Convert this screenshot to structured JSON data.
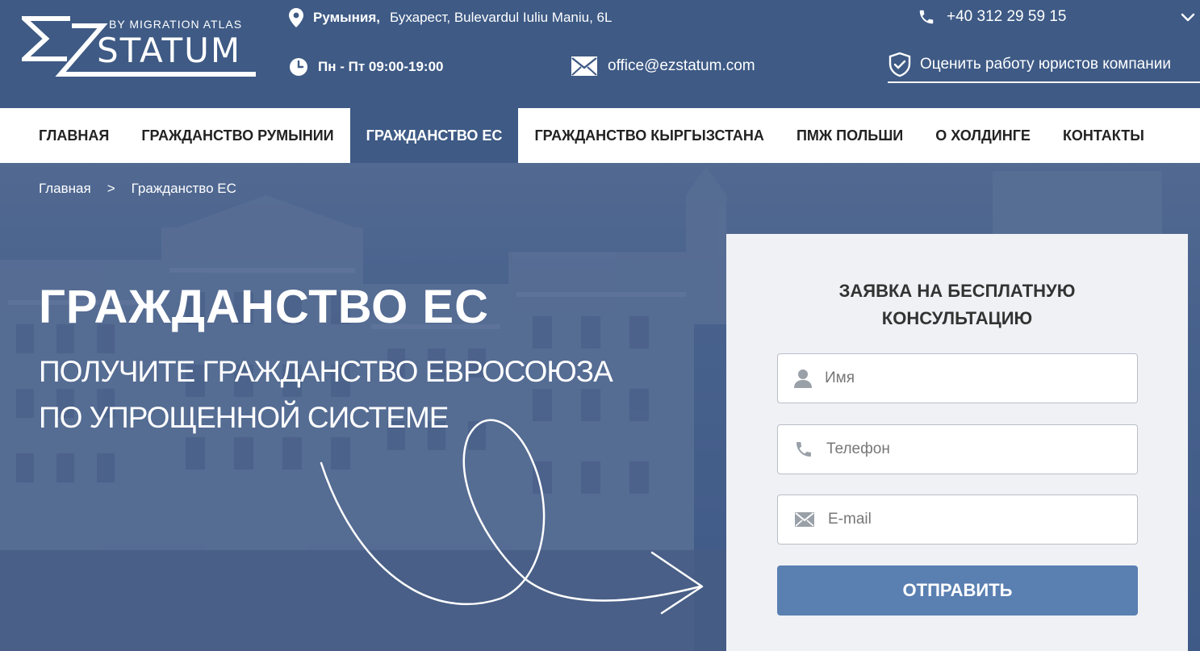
{
  "logo": {
    "tagline": "BY MIGRATION ATLAS",
    "wordmark": "STATUM"
  },
  "header": {
    "country": "Румыния,",
    "street": "Бухарест, Bulevardul Iuliu Maniu, 6L",
    "hours": "Пн - Пт  09:00-19:00",
    "email": "office@ezstatum.com",
    "phone": "+40 312 29 59 15",
    "rate_label": "Оценить работу юристов компании"
  },
  "nav": {
    "items": [
      {
        "label": "ГЛАВНАЯ"
      },
      {
        "label": "ГРАЖДАНСТВО РУМЫНИИ"
      },
      {
        "label": "ГРАЖДАНСТВО ЕС",
        "active": true
      },
      {
        "label": "ГРАЖДАНСТВО КЫРГЫЗСТАНА"
      },
      {
        "label": "ПМЖ ПОЛЬШИ"
      },
      {
        "label": "О ХОЛДИНГЕ"
      },
      {
        "label": "КОНТАКТЫ"
      }
    ]
  },
  "breadcrumb": {
    "home": "Главная",
    "separator": ">",
    "current": "Гражданство ЕС"
  },
  "hero": {
    "title": "ГРАЖДАНСТВО ЕС",
    "subtitle": "ПОЛУЧИТЕ ГРАЖДАНСТВО ЕВРОСОЮЗА ПО УПРОЩЕННОЙ СИСТЕМЕ"
  },
  "form": {
    "title_line1": "ЗАЯВКА НА БЕСПЛАТНУЮ",
    "title_line2": "КОНСУЛЬТАЦИЮ",
    "name_placeholder": "Имя",
    "phone_placeholder": "Телефон",
    "email_placeholder": "E-mail",
    "submit_label": "ОТПРАВИТЬ"
  },
  "colors": {
    "header_bg": "#3e5a85",
    "button_bg": "#5a7fb1",
    "form_bg": "#eff1f5"
  }
}
